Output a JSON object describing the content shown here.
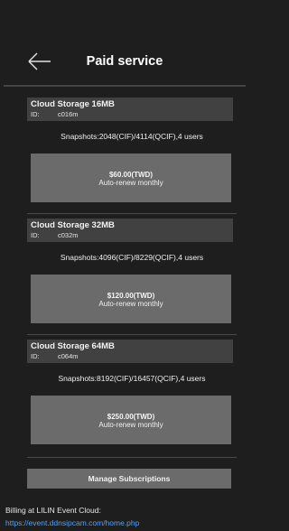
{
  "header": {
    "title": "Paid service",
    "back_icon": "arrow-left-icon"
  },
  "plans": [
    {
      "name": "Cloud Storage 16MB",
      "id_label": "ID:",
      "id_value": "c016m",
      "snapshots": "Snapshots:2048(CIF)/4114(QCIF),4 users",
      "price": "$60.00(TWD)",
      "renew": "Auto-renew monthly"
    },
    {
      "name": "Cloud Storage 32MB",
      "id_label": "ID:",
      "id_value": "c032m",
      "snapshots": "Snapshots:4096(CIF)/8229(QCIF),4 users",
      "price": "$120.00(TWD)",
      "renew": "Auto-renew monthly"
    },
    {
      "name": "Cloud Storage 64MB",
      "id_label": "ID:",
      "id_value": "c064m",
      "snapshots": "Snapshots:8192(CIF)/16457(QCIF),4 users",
      "price": "$250.00(TWD)",
      "renew": "Auto-renew monthly"
    }
  ],
  "manage_button": "Manage Subscriptions",
  "billing": {
    "label": "Billing at LILIN Event Cloud:",
    "link": "https://event.ddnsipcam.com/home.php"
  },
  "colors": {
    "background": "#1e1e1e",
    "panel": "#414141",
    "button": "#6b6b6b",
    "link": "#4da3ff"
  }
}
